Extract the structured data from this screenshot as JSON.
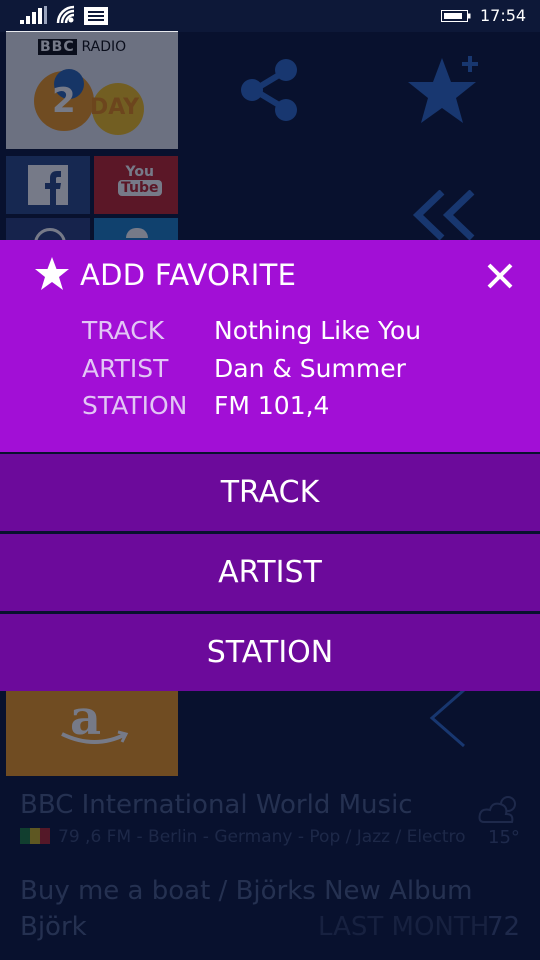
{
  "status_bar": {
    "time": "17:54"
  },
  "background": {
    "logo_text": {
      "bbc": "BBC",
      "radio": "RADIO",
      "two": "2",
      "day": "DAY"
    },
    "social": {
      "youtube_top": "You",
      "youtube_bottom": "Tube"
    },
    "station_name": "BBC International World Music",
    "station_meta": "79 ,6 FM - Berlin - Germany - Pop / Jazz / Electro",
    "weather_temp": "15°",
    "news_title": "Buy me a boat / Björks New Album",
    "news_artist": "Björk",
    "news_period": "LAST MONTH",
    "news_count": "72"
  },
  "dialog": {
    "title": "ADD FAVORITE",
    "rows": [
      {
        "label": "TRACK",
        "value": "Nothing Like You"
      },
      {
        "label": "ARTIST",
        "value": "Dan & Summer"
      },
      {
        "label": "STATION",
        "value": "FM 101,4"
      }
    ],
    "options": [
      "TRACK",
      "ARTIST",
      "STATION"
    ]
  },
  "colors": {
    "dialog_bg": "#a20fd6",
    "option_bg": "#6c0a9b",
    "app_bg": "#0d1838"
  }
}
